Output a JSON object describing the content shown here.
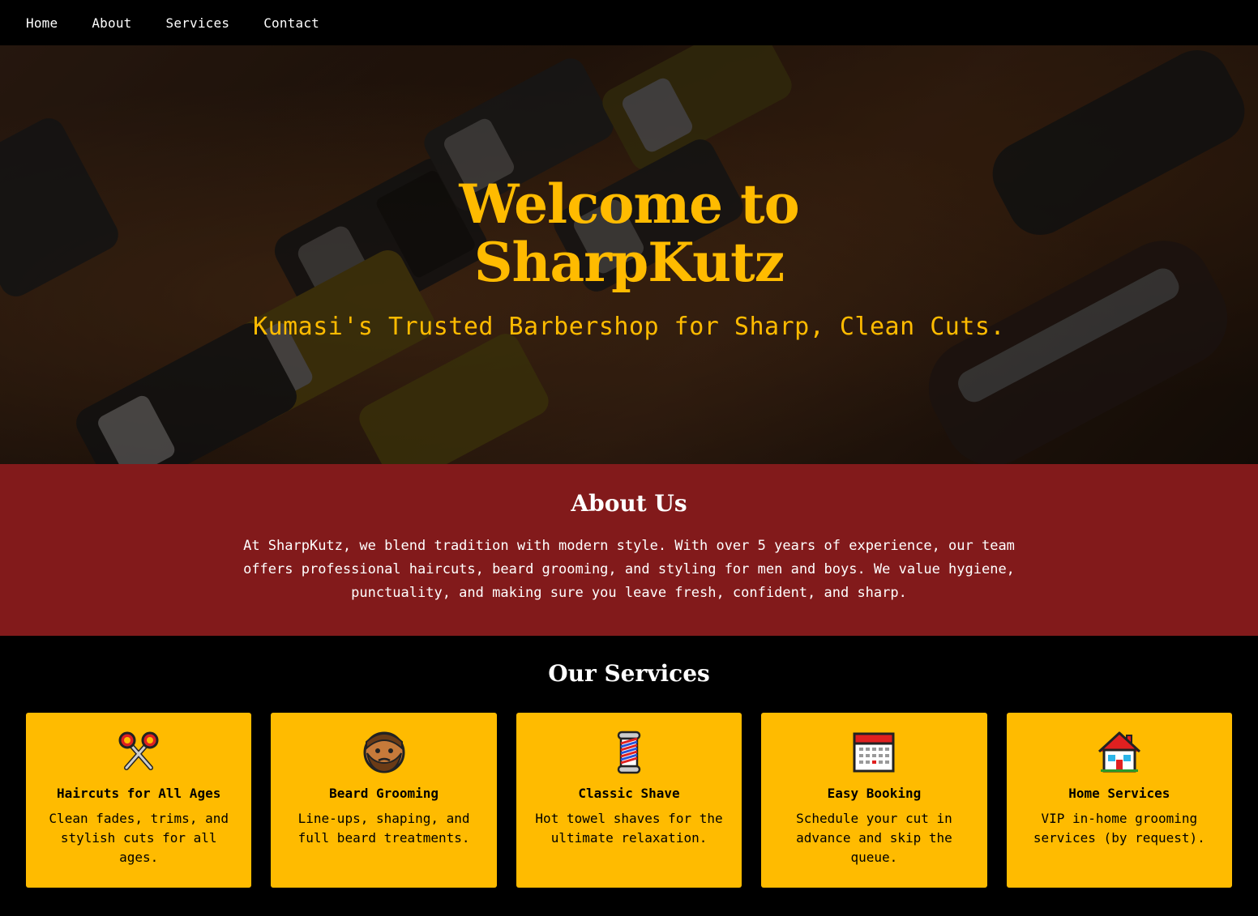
{
  "nav": {
    "items": [
      {
        "label": "Home"
      },
      {
        "label": "About"
      },
      {
        "label": "Services"
      },
      {
        "label": "Contact"
      }
    ]
  },
  "hero": {
    "title_line1": "Welcome to",
    "title_line2": "SharpKutz",
    "subtitle": "Kumasi's Trusted Barbershop for Sharp, Clean Cuts."
  },
  "about": {
    "heading": "About Us",
    "text": "At SharpKutz, we blend tradition with modern style. With over 5 years of experience, our team offers professional haircuts, beard grooming, and styling for men and boys. We value hygiene, punctuality, and making sure you leave fresh, confident, and sharp."
  },
  "services": {
    "heading": "Our Services",
    "cards": [
      {
        "icon": "scissors-icon",
        "title": "Haircuts for All Ages",
        "text": "Clean fades, trims, and stylish cuts for all ages."
      },
      {
        "icon": "bearded-man-icon",
        "title": "Beard Grooming",
        "text": "Line-ups, shaping, and full beard treatments."
      },
      {
        "icon": "barber-pole-icon",
        "title": "Classic Shave",
        "text": "Hot towel shaves for the ultimate relaxation."
      },
      {
        "icon": "calendar-icon",
        "title": "Easy Booking",
        "text": "Schedule your cut in advance and skip the queue."
      },
      {
        "icon": "house-icon",
        "title": "Home Services",
        "text": "VIP in-home grooming services (by request)."
      }
    ]
  },
  "colors": {
    "accent": "#ffbb00",
    "about_bg": "#821a1b",
    "nav_bg": "#000000"
  }
}
